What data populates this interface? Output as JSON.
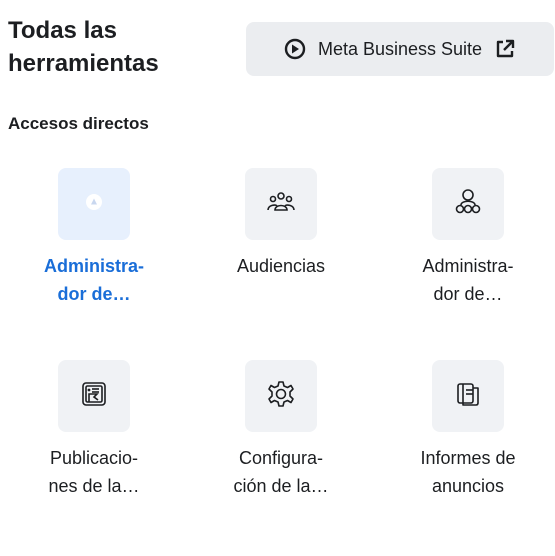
{
  "header": {
    "title": "Todas las herramientas",
    "suite_button_label": "Meta Business Suite"
  },
  "section_title": "Accesos directos",
  "shortcuts": [
    {
      "label": "Administra-\ndor de…",
      "icon": "ads-manager-icon",
      "active": true
    },
    {
      "label": "Audiencias",
      "icon": "audiences-icon",
      "active": false
    },
    {
      "label": "Administra-\ndor de…",
      "icon": "people-manager-icon",
      "active": false
    },
    {
      "label": "Publicacio-\nnes de la…",
      "icon": "page-posts-icon",
      "active": false
    },
    {
      "label": "Configura-\nción de la…",
      "icon": "settings-gear-icon",
      "active": false
    },
    {
      "label": "Informes de\nanuncios",
      "icon": "ads-reporting-icon",
      "active": false
    }
  ],
  "colors": {
    "accent": "#1a6ed8",
    "tile_bg": "#f0f2f5",
    "active_tile_bg": "#e7f0fd"
  }
}
